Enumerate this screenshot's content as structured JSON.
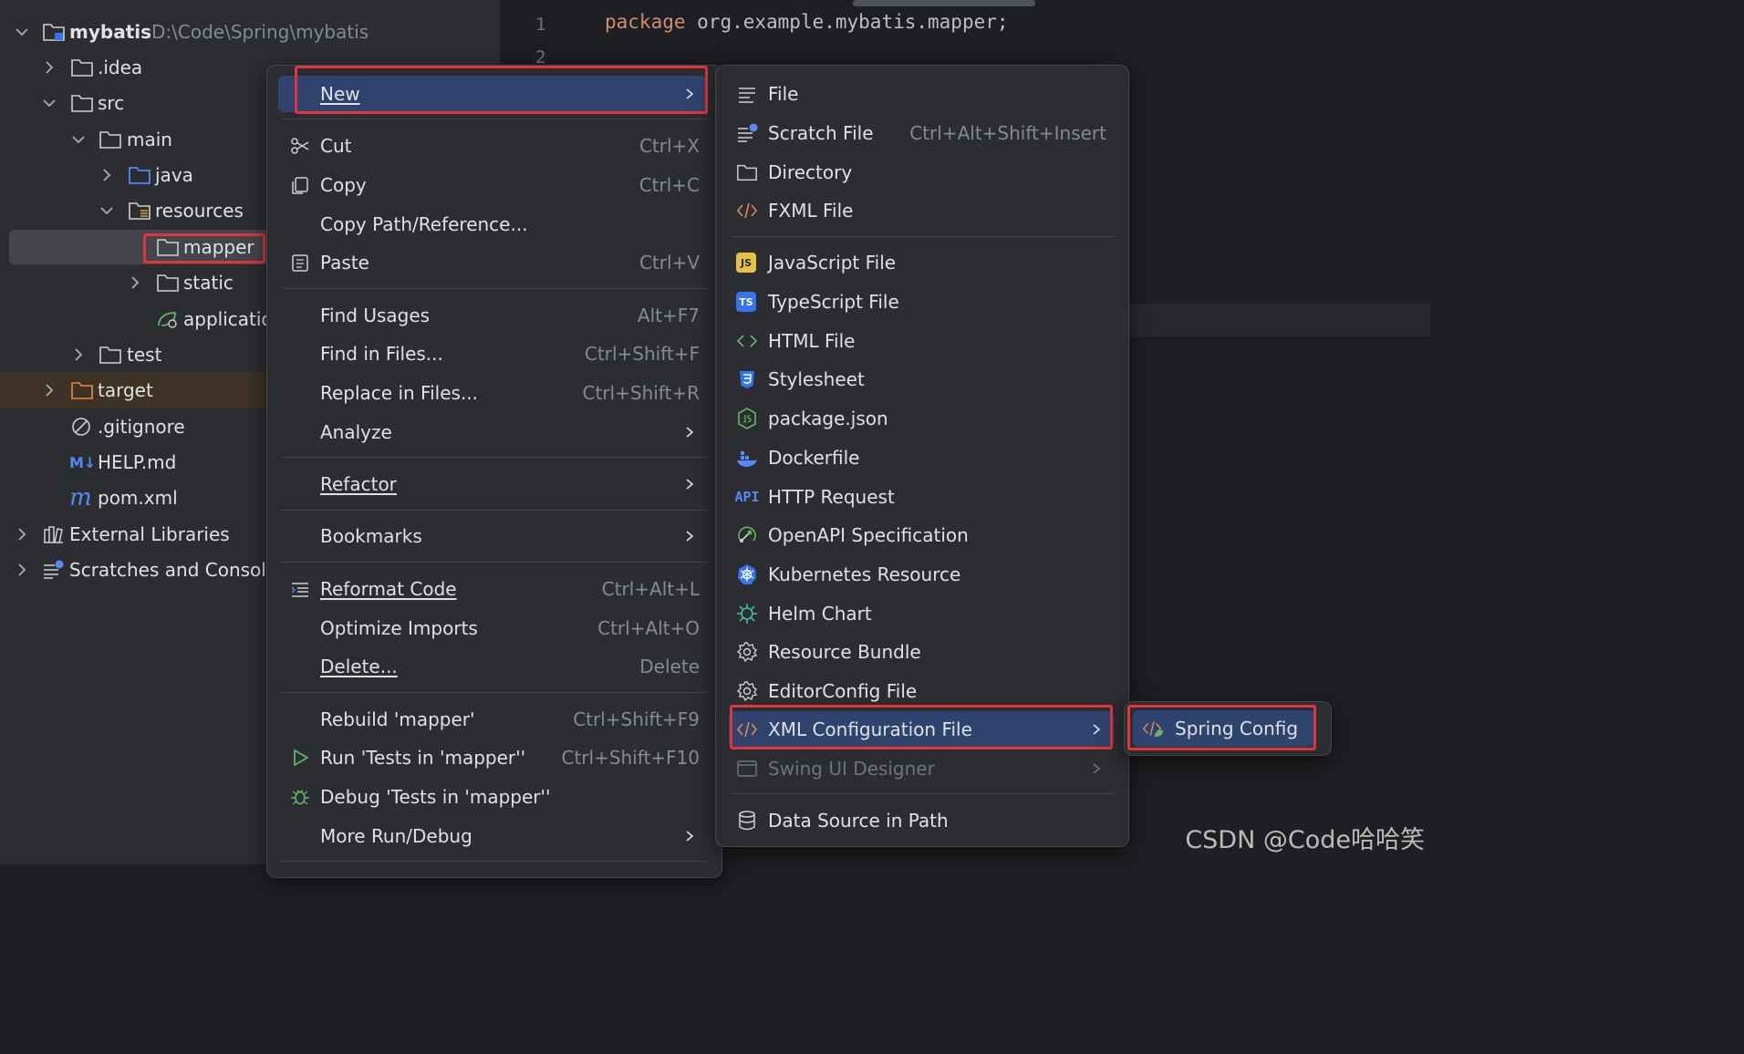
{
  "project_tree": {
    "root": {
      "name": "mybatis",
      "path": "D:\\Code\\Spring\\mybatis"
    },
    "items": [
      {
        "label": ".idea"
      },
      {
        "label": "src"
      },
      {
        "label": "main"
      },
      {
        "label": "java"
      },
      {
        "label": "resources"
      },
      {
        "label": "mapper"
      },
      {
        "label": "static"
      },
      {
        "label": "applicatio"
      },
      {
        "label": "test"
      },
      {
        "label": "target"
      },
      {
        "label": ".gitignore"
      },
      {
        "label": "HELP.md"
      },
      {
        "label": "pom.xml"
      },
      {
        "label": "External Libraries"
      },
      {
        "label": "Scratches and Consoles"
      }
    ]
  },
  "editor": {
    "line_numbers": [
      "1",
      "2"
    ],
    "code_keyword": "package",
    "code_rest": " org.example.mybatis.mapper;"
  },
  "context_menu": {
    "new": "New",
    "cut": {
      "label": "Cut",
      "shortcut": "Ctrl+X"
    },
    "copy": {
      "label": "Copy",
      "shortcut": "Ctrl+C"
    },
    "copy_path": {
      "label": "Copy Path/Reference..."
    },
    "paste": {
      "label": "Paste",
      "shortcut": "Ctrl+V"
    },
    "find_usages": {
      "label": "Find Usages",
      "shortcut": "Alt+F7"
    },
    "find_in_files": {
      "label": "Find in Files...",
      "shortcut": "Ctrl+Shift+F"
    },
    "replace_in_files": {
      "label": "Replace in Files...",
      "shortcut": "Ctrl+Shift+R"
    },
    "analyze": {
      "label": "Analyze"
    },
    "refactor": {
      "label": "Refactor"
    },
    "bookmarks": {
      "label": "Bookmarks"
    },
    "reformat": {
      "label": "Reformat Code",
      "shortcut": "Ctrl+Alt+L"
    },
    "optimize": {
      "label": "Optimize Imports",
      "shortcut": "Ctrl+Alt+O"
    },
    "delete": {
      "label": "Delete...",
      "shortcut": "Delete"
    },
    "rebuild": {
      "label": "Rebuild 'mapper'",
      "shortcut": "Ctrl+Shift+F9"
    },
    "run": {
      "label": "Run 'Tests in 'mapper''",
      "shortcut": "Ctrl+Shift+F10"
    },
    "debug": {
      "label": "Debug 'Tests in 'mapper''"
    },
    "more_run": {
      "label": "More Run/Debug"
    }
  },
  "new_submenu": {
    "file": "File",
    "scratch": {
      "label": "Scratch File",
      "shortcut": "Ctrl+Alt+Shift+Insert"
    },
    "directory": "Directory",
    "fxml": "FXML File",
    "javascript": "JavaScript File",
    "typescript": "TypeScript File",
    "html": "HTML File",
    "stylesheet": "Stylesheet",
    "package_json": "package.json",
    "dockerfile": "Dockerfile",
    "http": "HTTP Request",
    "openapi": "OpenAPI Specification",
    "kubernetes": "Kubernetes Resource",
    "helm": "Helm Chart",
    "resource_bundle": "Resource Bundle",
    "editorconfig": "EditorConfig File",
    "xml_config": "XML Configuration File",
    "swing": "Swing UI Designer",
    "data_source": "Data Source in Path"
  },
  "xml_submenu": {
    "spring_config": "Spring Config"
  },
  "icon_text": {
    "js": "JS",
    "ts": "TS",
    "api": "API",
    "md": "M↓",
    "pom": "m"
  },
  "watermark": "CSDN @Code哈哈笑",
  "colors": {
    "menu_bg": "#2b2d30",
    "highlight": "#2e436e",
    "red_annotation": "#e0353d",
    "keyword": "#cf8e6d"
  }
}
